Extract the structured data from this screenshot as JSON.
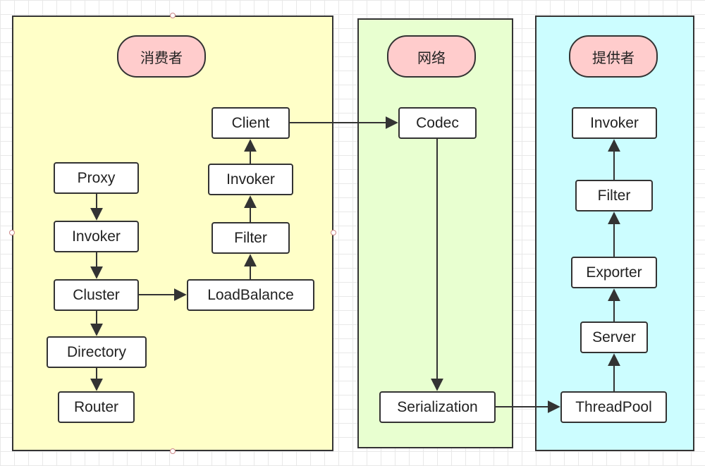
{
  "sections": {
    "consumer": {
      "title": "消费者",
      "nodes": {
        "proxy": "Proxy",
        "invoker": "Invoker",
        "cluster": "Cluster",
        "directory": "Directory",
        "router": "Router",
        "loadbalance": "LoadBalance",
        "filter": "Filter",
        "invoker2": "Invoker",
        "client": "Client"
      }
    },
    "network": {
      "title": "网络",
      "nodes": {
        "codec": "Codec",
        "serialization": "Serialization"
      }
    },
    "provider": {
      "title": "提供者",
      "nodes": {
        "threadpool": "ThreadPool",
        "server": "Server",
        "exporter": "Exporter",
        "filter": "Filter",
        "invoker": "Invoker"
      }
    }
  },
  "colors": {
    "consumer_bg": "#ffffc8",
    "network_bg": "#e8ffd0",
    "provider_bg": "#ccfdff",
    "title_pill": "#ffcccc",
    "stroke": "#333333"
  }
}
